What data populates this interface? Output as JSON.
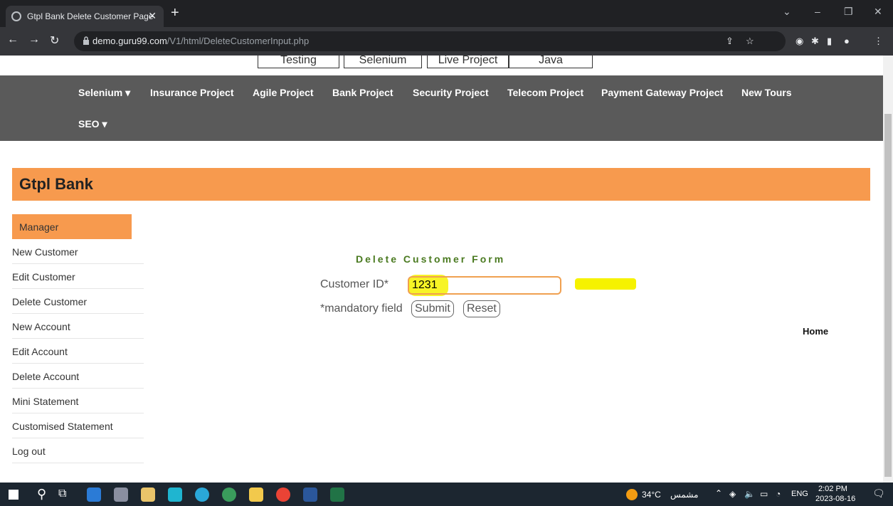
{
  "browser": {
    "tab_title": "Gtpl Bank Delete Customer Page",
    "url_host": "demo.guru99.com",
    "url_path": "/V1/html/DeleteCustomerInput.php"
  },
  "top_links": [
    "Testing",
    "Selenium",
    "Live Project",
    "Java"
  ],
  "navbar": {
    "items": [
      "Selenium ▾",
      "Insurance Project",
      "Agile Project",
      "Bank Project",
      "Security Project",
      "Telecom Project",
      "Payment Gateway Project",
      "New Tours"
    ],
    "seo": "SEO ▾"
  },
  "banner": {
    "name": "Gtpl Bank"
  },
  "sidebar": {
    "items": [
      "Manager",
      "New Customer",
      "Edit Customer",
      "Delete Customer",
      "New Account",
      "Edit Account",
      "Delete Account",
      "Mini Statement",
      "Customised Statement",
      "Log out"
    ]
  },
  "form": {
    "title": "Delete Customer Form",
    "customer_id_label": "Customer ID*",
    "customer_id_value": "1231",
    "mandatory_note": "*mandatory field",
    "submit_label": "Submit",
    "reset_label": "Reset"
  },
  "home_link": "Home",
  "taskbar": {
    "weather": "34°C",
    "weather_text": "مشمس",
    "lang": "ENG",
    "time": "2:02 PM",
    "date": "2023-08-16"
  },
  "colors": {
    "banner": "#f79a4e",
    "navbar": "#5a5a5a",
    "highlight": "#f6f200"
  }
}
